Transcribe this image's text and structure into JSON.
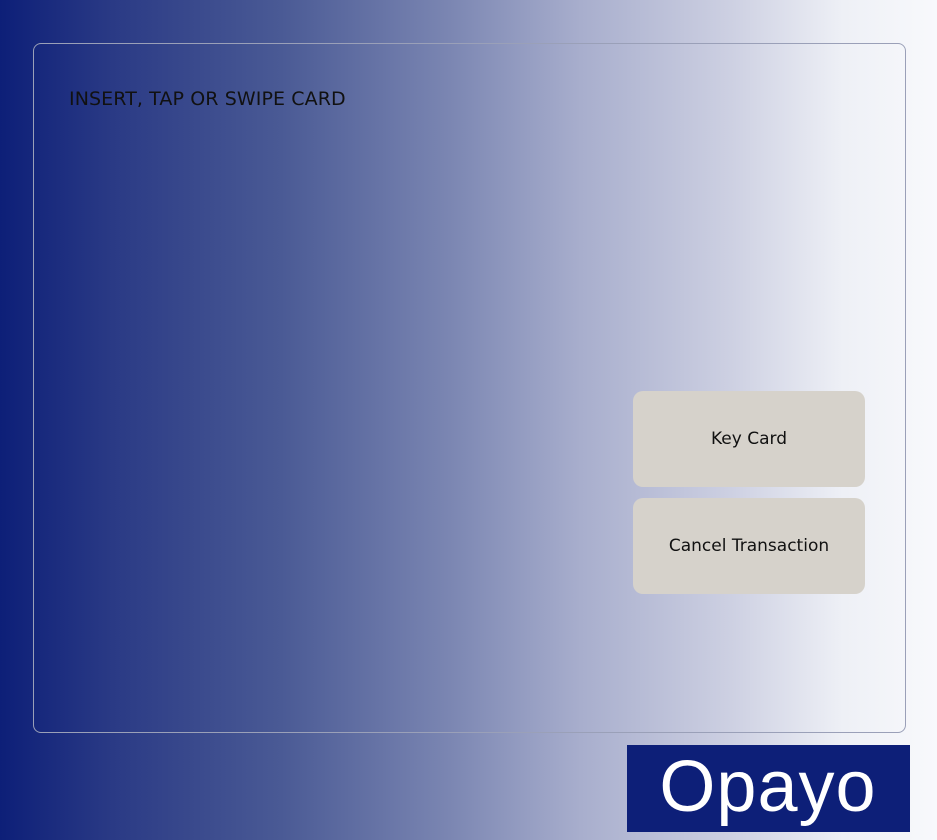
{
  "terminal": {
    "prompt": "INSERT, TAP OR SWIPE CARD",
    "buttons": {
      "key_card": "Key Card",
      "cancel_transaction": "Cancel Transaction"
    }
  },
  "brand": {
    "logo_text": "Opayo",
    "logo_bg": "#0d1f78",
    "logo_fg": "#ffffff"
  },
  "colors": {
    "gradient_left": "#0d1f78",
    "gradient_right": "#f8f9fc",
    "button_bg": "#d6d2cb"
  }
}
